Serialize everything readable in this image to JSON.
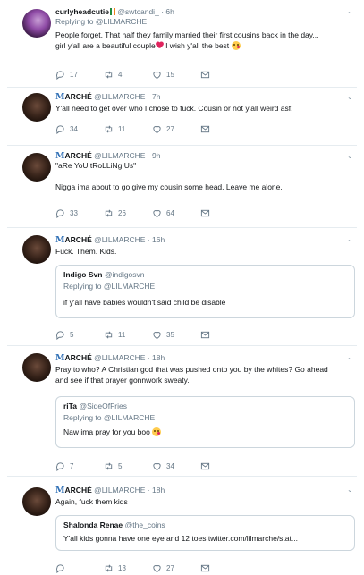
{
  "tweets": [
    {
      "name": "curlyheadcutie",
      "handle": "@swtcandi_",
      "time": "6h",
      "reply_prefix": "Replying to",
      "reply_to": "@LILMARCHE",
      "text_line1": "People forget. That half they family married their first cousins back in the day...",
      "text_line2a": "girl y'all are a beautiful couple",
      "text_line2b": " I wish y'all the best ",
      "replies": "17",
      "retweets": "4",
      "likes": "15"
    },
    {
      "name_m": "M",
      "name_rest": "ARCHÉ",
      "handle": "@LILMARCHE",
      "time": "7h",
      "text": "Y'all need to get over who I chose to fuck. Cousin or not y'all weird asf.",
      "replies": "34",
      "retweets": "11",
      "likes": "27"
    },
    {
      "name_m": "M",
      "name_rest": "ARCHÉ",
      "handle": "@LILMARCHE",
      "time": "9h",
      "text_line1": "\"aRe YoU tRoLLiNg Us\"",
      "text_line2": "Nigga ima about to go give my cousin some head. Leave me alone.",
      "replies": "33",
      "retweets": "26",
      "likes": "64"
    },
    {
      "name_m": "M",
      "name_rest": "ARCHÉ",
      "handle": "@LILMARCHE",
      "time": "16h",
      "text": "Fuck. Them. Kids.",
      "quote": {
        "name": "Indigo Svn",
        "handle": "@indigosvn",
        "reply_prefix": "Replying to",
        "reply_to": "@LILMARCHE",
        "text": "if y'all have babies wouldn't said  child be disable"
      },
      "replies": "5",
      "retweets": "11",
      "likes": "35"
    },
    {
      "name_m": "M",
      "name_rest": "ARCHÉ",
      "handle": "@LILMARCHE",
      "time": "18h",
      "text_line1": "Pray to who? A Christian god that was pushed onto you by the whites? Go ahead",
      "text_line2": "and see if that prayer gonnwork sweaty.",
      "quote": {
        "name": "riTa",
        "handle": "@SideOfFries__",
        "reply_prefix": "Replying to",
        "reply_to": "@LILMARCHE",
        "text": "Naw ima pray for you boo "
      },
      "replies": "7",
      "retweets": "5",
      "likes": "34"
    },
    {
      "name_m": "M",
      "name_rest": "ARCHÉ",
      "handle": "@LILMARCHE",
      "time": "18h",
      "text": "Again, fuck them kids",
      "quote": {
        "name": "Shalonda Renae",
        "handle": "@the_coins",
        "text": "Y'all kids gonna have one eye and 12 toes twitter.com/lilmarche/stat..."
      },
      "replies": "",
      "retweets": "13",
      "likes": "27"
    }
  ],
  "dot": "·",
  "icons": {
    "reply": "reply-icon",
    "retweet": "retweet-icon",
    "like": "heart-icon",
    "dm": "envelope-icon",
    "caret": "chevron-down-icon"
  }
}
